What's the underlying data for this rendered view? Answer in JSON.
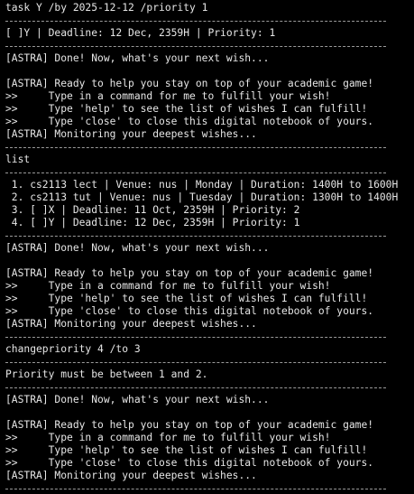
{
  "terminal": {
    "lines": [
      "task Y /by 2025-12-12 /priority 1",
      "---",
      "[ ]Y | Deadline: 12 Dec, 2359H | Priority: 1",
      "---",
      "[ASTRA] Done! Now, what's your next wish...",
      "",
      "[ASTRA] Ready to help you stay on top of your academic game!",
      ">>     Type in a command for me to fulfill your wish!",
      ">>     Type 'help' to see the list of wishes I can fulfill!",
      ">>     Type 'close' to close this digital notebook of yours.",
      "[ASTRA] Monitoring your deepest wishes...",
      "---",
      "list",
      "---",
      " 1. cs2113 lect | Venue: nus | Monday | Duration: 1400H to 1600H",
      " 2. cs2113 tut | Venue: nus | Tuesday | Duration: 1300H to 1400H",
      " 3. [ ]X | Deadline: 11 Oct, 2359H | Priority: 2",
      " 4. [ ]Y | Deadline: 12 Dec, 2359H | Priority: 1",
      "---",
      "[ASTRA] Done! Now, what's your next wish...",
      "",
      "[ASTRA] Ready to help you stay on top of your academic game!",
      ">>     Type in a command for me to fulfill your wish!",
      ">>     Type 'help' to see the list of wishes I can fulfill!",
      ">>     Type 'close' to close this digital notebook of yours.",
      "[ASTRA] Monitoring your deepest wishes...",
      "---",
      "changepriority 4 /to 3",
      "---",
      "Priority must be between 1 and 2.",
      "---",
      "[ASTRA] Done! Now, what's your next wish...",
      "",
      "[ASTRA] Ready to help you stay on top of your academic game!",
      ">>     Type in a command for me to fulfill your wish!",
      ">>     Type 'help' to see the list of wishes I can fulfill!",
      ">>     Type 'close' to close this digital notebook of yours.",
      "[ASTRA] Monitoring your deepest wishes...",
      "---"
    ]
  },
  "colors": {
    "background": "#000000",
    "text": "#e6e6e6",
    "separator": "#9a9a9a"
  }
}
